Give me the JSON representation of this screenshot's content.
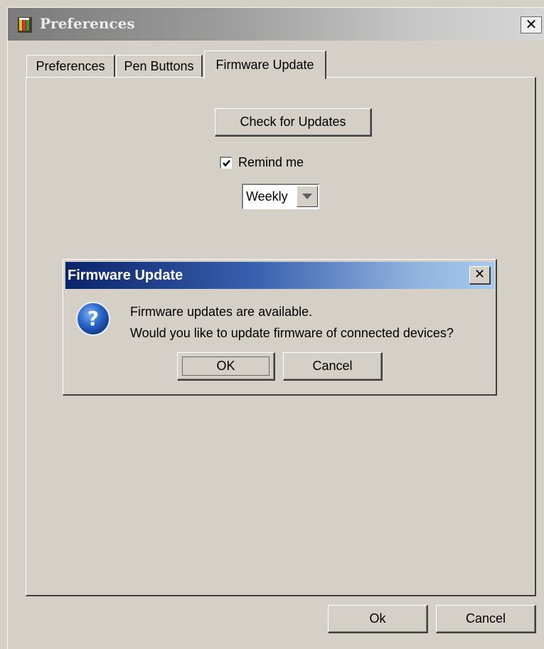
{
  "window": {
    "title": "Preferences",
    "close_glyph": "✕",
    "app_icon": "app-icon"
  },
  "tabs": [
    {
      "label": "Preferences",
      "selected": false
    },
    {
      "label": "Pen Buttons",
      "selected": false
    },
    {
      "label": "Firmware Update",
      "selected": true
    }
  ],
  "firmware_panel": {
    "check_button_label": "Check for Updates",
    "remind_checkbox": {
      "label": "Remind me",
      "checked": true
    },
    "frequency_dropdown": {
      "selected": "Weekly"
    }
  },
  "footer": {
    "ok_label": "Ok",
    "cancel_label": "Cancel"
  },
  "dialog": {
    "title": "Firmware Update",
    "close_glyph": "✕",
    "icon": "question-icon",
    "message_line1": "Firmware updates are available.",
    "message_line2": "Would you like to update firmware of connected devices?",
    "ok_label": "OK",
    "cancel_label": "Cancel"
  },
  "colors": {
    "window_bg": "#d4d0c8",
    "dialog_title_start": "#0a246a",
    "dialog_title_end": "#a6caf0",
    "question_icon_blue": "#1f56b8"
  }
}
